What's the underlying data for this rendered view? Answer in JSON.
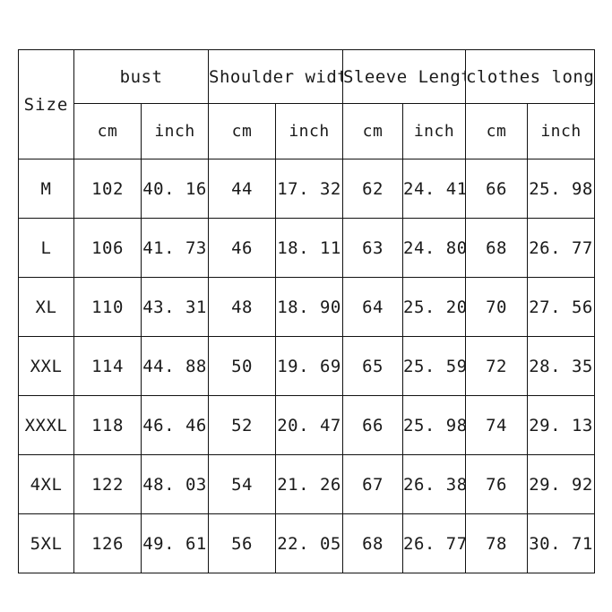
{
  "table": {
    "size_header": "Size",
    "groups": [
      {
        "label": "bust",
        "units": [
          "cm",
          "inch"
        ]
      },
      {
        "label": "Shoulder width",
        "units": [
          "cm",
          "inch"
        ]
      },
      {
        "label": "Sleeve Length",
        "units": [
          "cm",
          "inch"
        ]
      },
      {
        "label": "clothes long",
        "units": [
          "cm",
          "inch"
        ]
      }
    ],
    "rows": [
      {
        "size": "M",
        "bust_cm": "102",
        "bust_inch": "40. 16",
        "shoulder_cm": "44",
        "shoulder_inch": "17. 32",
        "sleeve_cm": "62",
        "sleeve_inch": "24. 41",
        "length_cm": "66",
        "length_inch": "25. 98"
      },
      {
        "size": "L",
        "bust_cm": "106",
        "bust_inch": "41. 73",
        "shoulder_cm": "46",
        "shoulder_inch": "18. 11",
        "sleeve_cm": "63",
        "sleeve_inch": "24. 80",
        "length_cm": "68",
        "length_inch": "26. 77"
      },
      {
        "size": "XL",
        "bust_cm": "110",
        "bust_inch": "43. 31",
        "shoulder_cm": "48",
        "shoulder_inch": "18. 90",
        "sleeve_cm": "64",
        "sleeve_inch": "25. 20",
        "length_cm": "70",
        "length_inch": "27. 56"
      },
      {
        "size": "XXL",
        "bust_cm": "114",
        "bust_inch": "44. 88",
        "shoulder_cm": "50",
        "shoulder_inch": "19. 69",
        "sleeve_cm": "65",
        "sleeve_inch": "25. 59",
        "length_cm": "72",
        "length_inch": "28. 35"
      },
      {
        "size": "XXXL",
        "bust_cm": "118",
        "bust_inch": "46. 46",
        "shoulder_cm": "52",
        "shoulder_inch": "20. 47",
        "sleeve_cm": "66",
        "sleeve_inch": "25. 98",
        "length_cm": "74",
        "length_inch": "29. 13"
      },
      {
        "size": "4XL",
        "bust_cm": "122",
        "bust_inch": "48. 03",
        "shoulder_cm": "54",
        "shoulder_inch": "21. 26",
        "sleeve_cm": "67",
        "sleeve_inch": "26. 38",
        "length_cm": "76",
        "length_inch": "29. 92"
      },
      {
        "size": "5XL",
        "bust_cm": "126",
        "bust_inch": "49. 61",
        "shoulder_cm": "56",
        "shoulder_inch": "22. 05",
        "sleeve_cm": "68",
        "sleeve_inch": "26. 77",
        "length_cm": "78",
        "length_inch": "30. 71"
      }
    ]
  },
  "colors": {
    "border": "#121212",
    "text": "#1a1a1a",
    "background": "#ffffff"
  }
}
